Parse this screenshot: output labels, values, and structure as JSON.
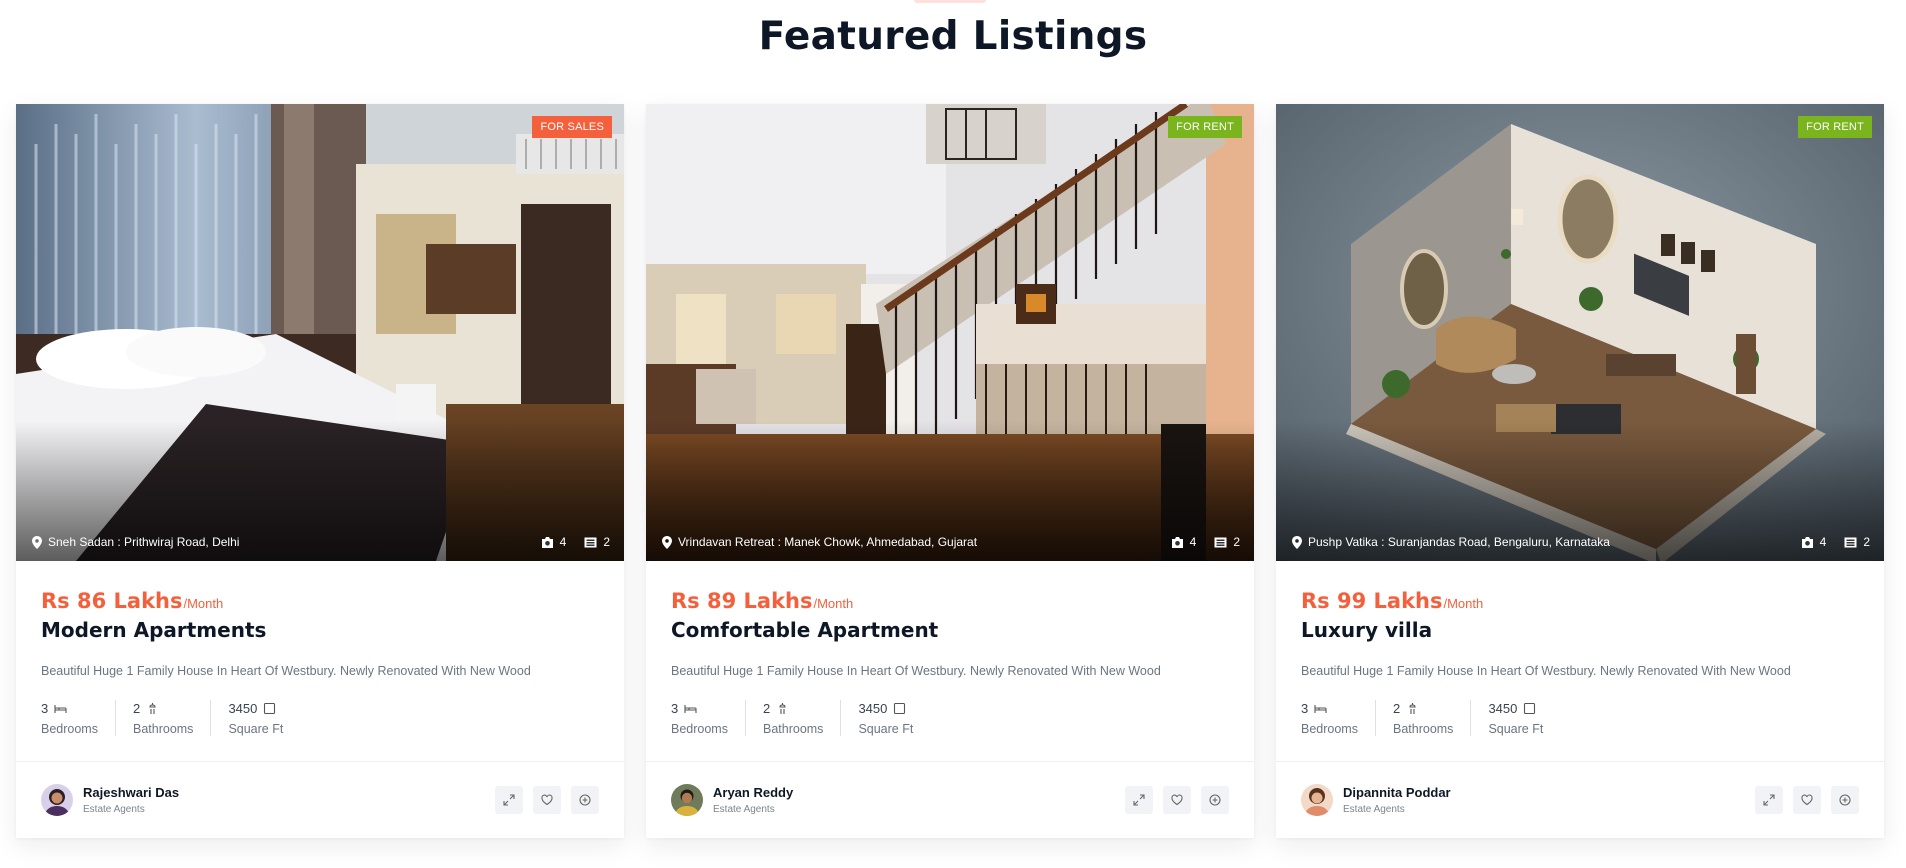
{
  "section": {
    "title": "Featured Listings"
  },
  "colors": {
    "accent": "#f4603c",
    "sale_badge": "#f4603c",
    "rent_badge": "#7ab51d"
  },
  "listings": [
    {
      "badge": "FOR SALES",
      "badge_color": "#f4603c",
      "location": "Sneh Sadan : Prithwiraj Road, Delhi",
      "photos": "4",
      "videos": "2",
      "price": "Rs 86 Lakhs",
      "period": "/Month",
      "name": "Modern Apartments",
      "description": "Beautiful Huge 1 Family House In Heart Of Westbury. Newly Renovated With New Wood",
      "bedrooms": "3",
      "bedrooms_label": "Bedrooms",
      "bathrooms": "2",
      "bathrooms_label": "Bathrooms",
      "area": "3450",
      "area_label": "Square Ft",
      "agent_name": "Rajeshwari Das",
      "agent_role": "Estate Agents",
      "image": "bedroom-photo"
    },
    {
      "badge": "FOR RENT",
      "badge_color": "#7ab51d",
      "location": "Vrindavan Retreat : Manek Chowk, Ahmedabad, Gujarat",
      "photos": "4",
      "videos": "2",
      "price": "Rs 89 Lakhs",
      "period": "/Month",
      "name": "Comfortable Apartment",
      "description": "Beautiful Huge 1 Family House In Heart Of Westbury. Newly Renovated With New Wood",
      "bedrooms": "3",
      "bedrooms_label": "Bedrooms",
      "bathrooms": "2",
      "bathrooms_label": "Bathrooms",
      "area": "3450",
      "area_label": "Square Ft",
      "agent_name": "Aryan Reddy",
      "agent_role": "Estate Agents",
      "image": "staircase-photo"
    },
    {
      "badge": "FOR RENT",
      "badge_color": "#7ab51d",
      "location": "Pushp Vatika : Suranjandas Road, Bengaluru, Karnataka",
      "photos": "4",
      "videos": "2",
      "price": "Rs 99 Lakhs",
      "period": "/Month",
      "name": "Luxury villa",
      "description": "Beautiful Huge 1 Family House In Heart Of Westbury. Newly Renovated With New Wood",
      "bedrooms": "3",
      "bedrooms_label": "Bedrooms",
      "bathrooms": "2",
      "bathrooms_label": "Bathrooms",
      "area": "3450",
      "area_label": "Square Ft",
      "agent_name": "Dipannita Poddar",
      "agent_role": "Estate Agents",
      "image": "isometric-room-photo"
    }
  ]
}
